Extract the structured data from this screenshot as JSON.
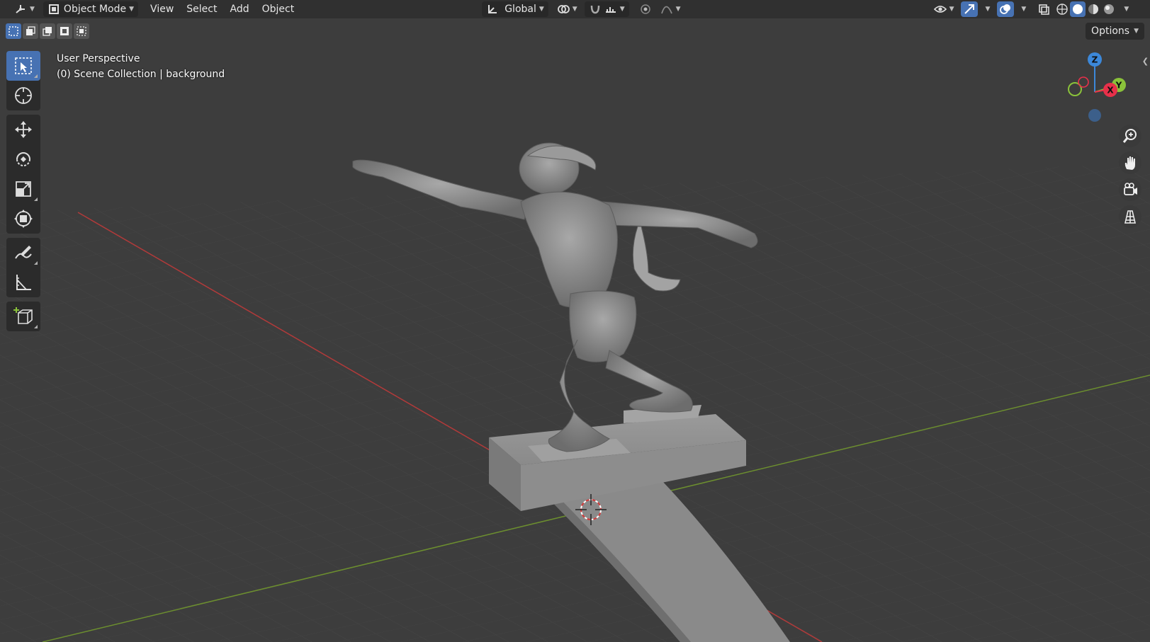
{
  "header": {
    "mode_label": "Object Mode",
    "menus": [
      "View",
      "Select",
      "Add",
      "Object"
    ],
    "orientation_label": "Global",
    "icons": [
      "editor-type-icon",
      "object-mode-icon",
      "transform-orientation-icon",
      "pivot-point-icon",
      "snap-icon",
      "snap-target-icon",
      "proportional-edit-icon",
      "falloff-icon",
      "visibility-icon",
      "gizmo-icon",
      "overlay-icon",
      "xray-icon",
      "wireframe-shading-icon",
      "solid-shading-icon",
      "material-shading-icon",
      "rendered-shading-icon"
    ]
  },
  "subbar": {
    "select_modes": [
      "select-new-icon",
      "select-extend-icon",
      "select-subtract-icon",
      "select-invert-icon",
      "select-intersect-icon"
    ],
    "options_label": "Options"
  },
  "toolbar": {
    "tools": [
      "select-box-tool",
      "cursor-tool",
      "move-tool",
      "rotate-tool",
      "scale-tool",
      "transform-tool",
      "annotate-tool",
      "measure-tool",
      "add-cube-tool"
    ]
  },
  "viewport": {
    "perspective_label": "User Perspective",
    "collection_label": "(0) Scene Collection | background"
  },
  "nav_gizmo": {
    "axes": [
      "Z",
      "Y",
      "X"
    ],
    "colors": {
      "x": "#e8304a",
      "y": "#8ac23a",
      "z": "#3c88d9"
    },
    "buttons": [
      "zoom-icon",
      "pan-hand-icon",
      "camera-view-icon",
      "ortho-grid-icon"
    ]
  },
  "colors": {
    "background": "#3d3d3d",
    "header": "#303030",
    "accent": "#4772b3",
    "grid_x_axis": "#b23a3a",
    "grid_y_axis": "#6c8e2f"
  }
}
